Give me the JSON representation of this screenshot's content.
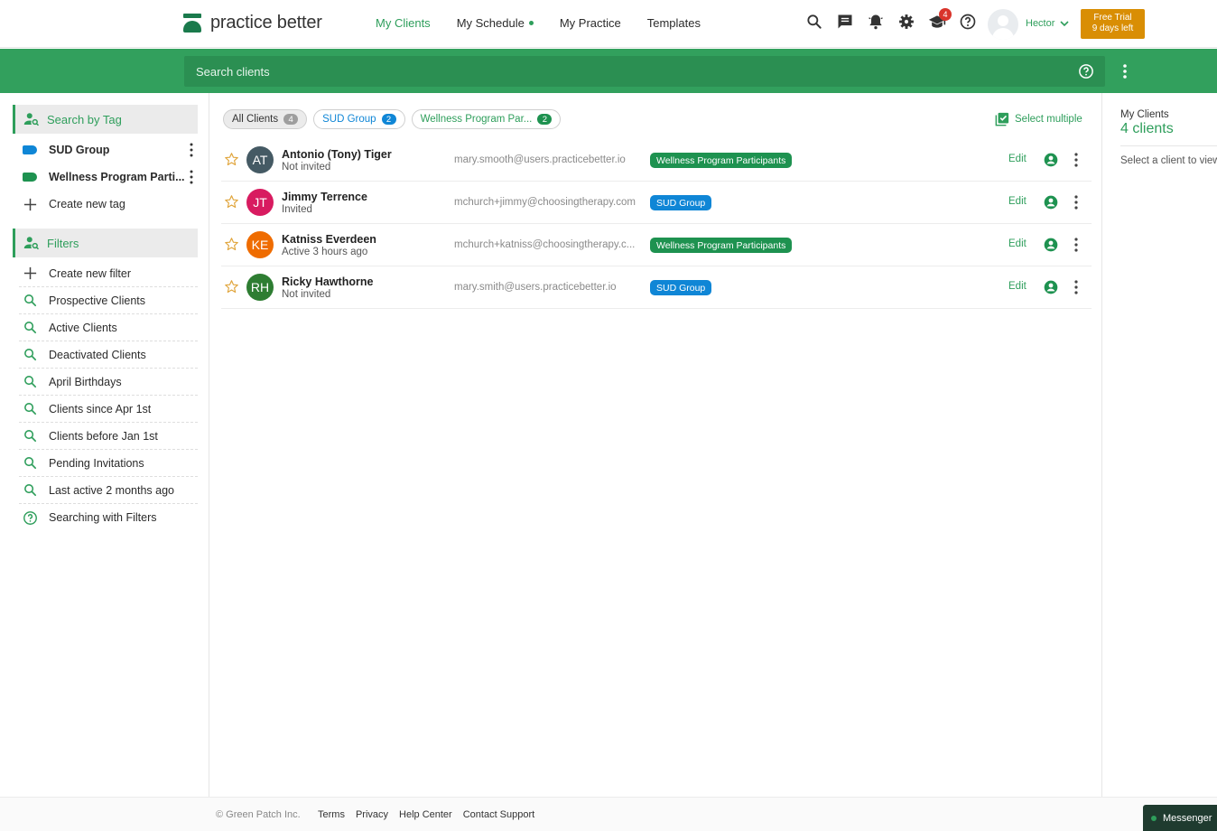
{
  "brand": {
    "name": "practice better",
    "color": "#1a7a4c"
  },
  "nav": {
    "links": [
      {
        "label": "My Clients",
        "active": true
      },
      {
        "label": "My Schedule",
        "active": false,
        "dot": true
      },
      {
        "label": "My Practice",
        "active": false
      },
      {
        "label": "Templates",
        "active": false
      }
    ],
    "icons": [
      "search-icon",
      "chat-icon",
      "bell-icon",
      "gear-icon",
      "graduation-cap-icon",
      "help-icon"
    ],
    "notification_count": "4",
    "user_name": "Hector",
    "trial": {
      "line1": "Free Trial",
      "line2": "9 days left",
      "color": "#d98e04"
    }
  },
  "search": {
    "placeholder": "Search clients",
    "value": ""
  },
  "sidebar": {
    "tags_header": "Search by Tag",
    "tags": [
      {
        "label": "SUD Group",
        "color": "#0f86d6"
      },
      {
        "label": "Wellness Program Parti...",
        "color": "#1e9250"
      }
    ],
    "create_tag": "Create new tag",
    "filters_header": "Filters",
    "create_filter": "Create new filter",
    "filters": [
      "Prospective Clients",
      "Active Clients",
      "Deactivated Clients",
      "April Birthdays",
      "Clients since Apr 1st",
      "Clients before Jan 1st",
      "Pending Invitations",
      "Last active 2 months ago"
    ],
    "help_filter": "Searching with Filters"
  },
  "chips": [
    {
      "label": "All Clients",
      "count": "4",
      "style": "sel"
    },
    {
      "label": "SUD Group",
      "count": "2",
      "style": "blue"
    },
    {
      "label": "Wellness Program Par...",
      "count": "2",
      "style": "green"
    }
  ],
  "select_multiple": "Select multiple",
  "clients": [
    {
      "initials": "AT",
      "avatar_color": "#455a64",
      "name": "Antonio (Tony) Tiger",
      "status": "Not invited",
      "email": "mary.smooth@users.practicebetter.io",
      "tag": "Wellness Program Participants",
      "tag_style": "green",
      "edit": "Edit"
    },
    {
      "initials": "JT",
      "avatar_color": "#d81b60",
      "name": "Jimmy Terrence",
      "status": "Invited",
      "email": "mchurch+jimmy@choosingtherapy.com",
      "tag": "SUD Group",
      "tag_style": "blue",
      "edit": "Edit"
    },
    {
      "initials": "KE",
      "avatar_color": "#ef6c00",
      "name": "Katniss Everdeen",
      "status": "Active 3 hours ago",
      "email": "mchurch+katniss@choosingtherapy.c...",
      "tag": "Wellness Program Participants",
      "tag_style": "green",
      "edit": "Edit"
    },
    {
      "initials": "RH",
      "avatar_color": "#2e7d32",
      "name": "Ricky Hawthorne",
      "status": "Not invited",
      "email": "mary.smith@users.practicebetter.io",
      "tag": "SUD Group",
      "tag_style": "blue",
      "edit": "Edit"
    }
  ],
  "right_panel": {
    "title": "My Clients",
    "count": "4 clients",
    "hint": "Select a client to view"
  },
  "footer": {
    "copyright": "© Green Patch Inc.",
    "links": [
      "Terms",
      "Privacy",
      "Help Center",
      "Contact Support"
    ],
    "messenger": "Messenger"
  }
}
